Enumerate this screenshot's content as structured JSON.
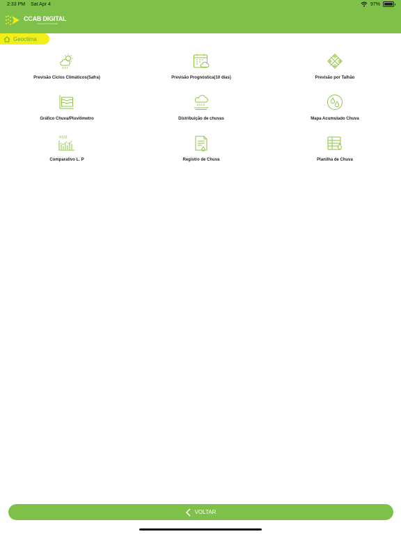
{
  "status_bar": {
    "time": "2:33 PM",
    "date": "Sat Apr 4",
    "battery_percent": "97%",
    "battery_level": 0.97,
    "icons": [
      "wifi-icon",
      "battery-icon"
    ]
  },
  "header": {
    "logo_text": "CCAB DIGITAL",
    "logo_subtext": "Powered by Geoferas"
  },
  "breadcrumb": {
    "label": "Geoclima",
    "icon": "home-icon"
  },
  "menu": [
    {
      "label": "Previsão Ciclos Climáticos(Safra)",
      "icon": "cloud-sun-icon"
    },
    {
      "label": "Previsão Prognóstica(10 dias)",
      "icon": "calendar-cloud-icon"
    },
    {
      "label": "Previsão por Talhão",
      "icon": "field-plots-icon"
    },
    {
      "label": "Gráfico Chuva/Pluviômetro",
      "icon": "rain-chart-icon"
    },
    {
      "label": "Distribuição de chuvas",
      "icon": "rain-cloud-icon"
    },
    {
      "label": "Mapa Acumulado Chuva",
      "icon": "droplets-map-icon"
    },
    {
      "label": "Comparativo L. P",
      "icon": "comparison-chart-icon"
    },
    {
      "label": "Registro de Chuva",
      "icon": "rain-record-icon"
    },
    {
      "label": "Planilha de Chuva",
      "icon": "rain-sheet-icon"
    }
  ],
  "footer": {
    "back_label": "VOLTAR"
  },
  "colors": {
    "header": "#7fc04a",
    "breadcrumb": "#f2ee18",
    "icon_stroke": "#8cc63f"
  }
}
